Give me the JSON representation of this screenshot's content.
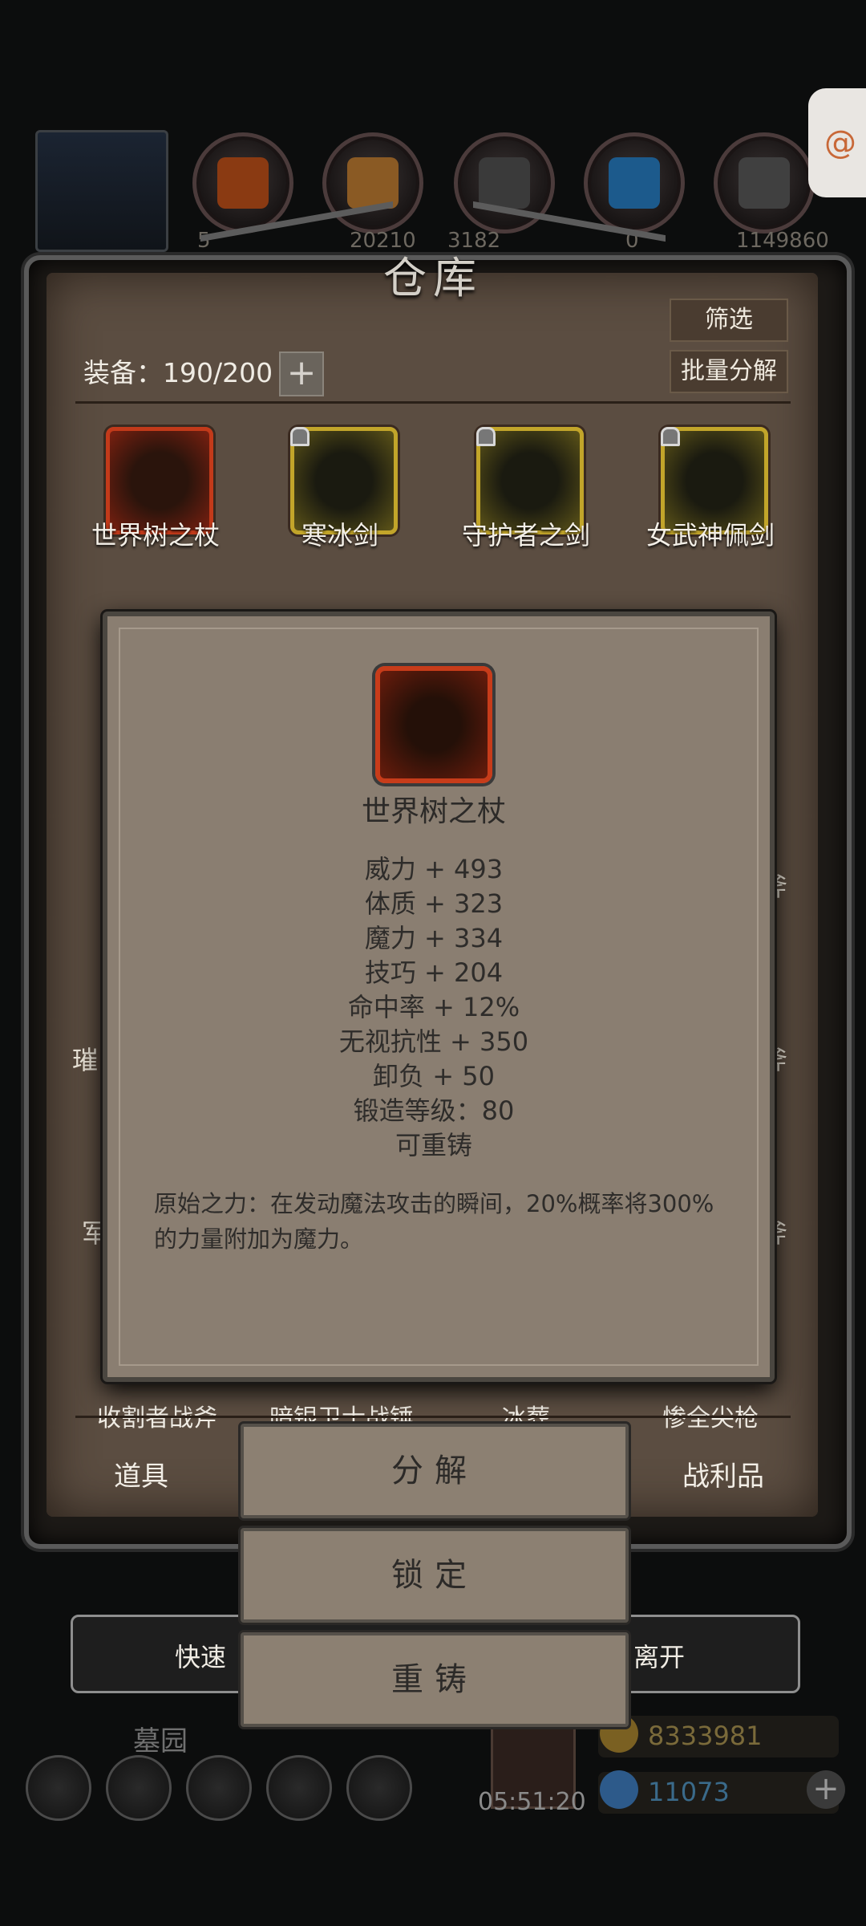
{
  "header": {
    "resource_numbers": [
      "5",
      "20210",
      "3182",
      "0",
      "1149860"
    ]
  },
  "warehouse": {
    "title": "仓库",
    "filter_button": "筛选",
    "batch_decompose_button": "批量分解",
    "capacity": "装备：190/200",
    "add_capacity": "+",
    "items_row1": [
      "世界树之杖",
      "寒冰剑",
      "守护者之剑",
      "女武神佩剑"
    ],
    "items_row_left_partial": [
      "璀",
      "军"
    ],
    "items_row_right_partial": [
      "斧",
      "斧",
      "斧"
    ],
    "bottom_partial_names": [
      "收割者战斧",
      "暗银卫士战锤",
      "冰葬",
      "惨全尖枪"
    ],
    "tabs": {
      "left": "道具",
      "right": "战利品"
    }
  },
  "tooltip": {
    "item_name": "世界树之杖",
    "stats": [
      "威力 + 493",
      "体质 + 323",
      "魔力 + 334",
      "技巧 + 204",
      "命中率 + 12%",
      "无视抗性 + 350",
      "卸负 + 50",
      "锻造等级：80",
      "可重铸"
    ],
    "description": "原始之力：在发动魔法攻击的瞬间，20%概率将300%的力量附加为魔力。"
  },
  "actions": {
    "decompose": "分解",
    "lock": "锁定",
    "reforge": "重铸"
  },
  "quick_bar": {
    "left": "快速",
    "right": "离开"
  },
  "footer": {
    "location": "墓园",
    "timer": "05:51:20",
    "gold": "8333981",
    "gems": "11073",
    "add": "+"
  },
  "side_tab_icon": "swirl-icon"
}
